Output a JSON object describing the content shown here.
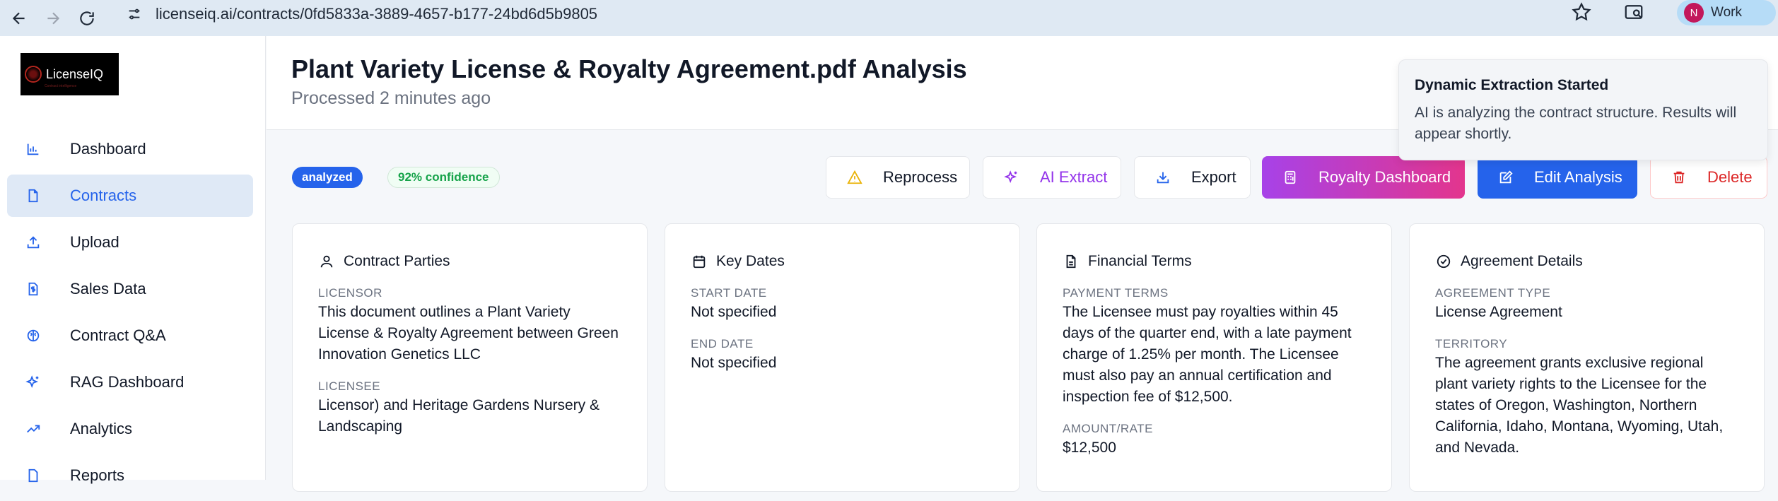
{
  "browser": {
    "url": "licenseiq.ai/contracts/0fd5833a-3889-4657-b177-24bd6d5b9805",
    "profile_initial": "N",
    "profile_label": "Work"
  },
  "sidebar": {
    "logo_text": "LicenseIQ",
    "logo_tagline": "Contract intelligence",
    "items": [
      {
        "label": "Dashboard",
        "icon": "bar-chart-icon"
      },
      {
        "label": "Contracts",
        "icon": "file-icon",
        "active": true
      },
      {
        "label": "Upload",
        "icon": "upload-icon"
      },
      {
        "label": "Sales Data",
        "icon": "dollar-file-icon"
      },
      {
        "label": "Contract Q&A",
        "icon": "brain-icon"
      },
      {
        "label": "RAG Dashboard",
        "icon": "sparkles-icon"
      },
      {
        "label": "Analytics",
        "icon": "trending-up-icon"
      },
      {
        "label": "Reports",
        "icon": "report-icon"
      }
    ]
  },
  "header": {
    "title": "Plant Variety License & Royalty Agreement.pdf Analysis",
    "subtitle": "Processed 2 minutes ago"
  },
  "toast": {
    "title": "Dynamic Extraction Started",
    "message": "AI is analyzing the contract structure. Results will appear shortly."
  },
  "badges": {
    "status": "analyzed",
    "confidence": "92% confidence"
  },
  "actions": {
    "reprocess": "Reprocess",
    "ai_extract": "AI Extract",
    "export": "Export",
    "royalty_dashboard": "Royalty Dashboard",
    "edit_analysis": "Edit Analysis",
    "delete": "Delete"
  },
  "cards": {
    "parties": {
      "title": "Contract Parties",
      "licensor_label": "LICENSOR",
      "licensor_value": "This document outlines a Plant Variety License & Royalty Agreement between Green Innovation Genetics LLC",
      "licensee_label": "LICENSEE",
      "licensee_value": "Licensor) and Heritage Gardens Nursery & Landscaping"
    },
    "dates": {
      "title": "Key Dates",
      "start_label": "START DATE",
      "start_value": "Not specified",
      "end_label": "END DATE",
      "end_value": "Not specified"
    },
    "financial": {
      "title": "Financial Terms",
      "payment_label": "PAYMENT TERMS",
      "payment_value": "The Licensee must pay royalties within 45 days of the quarter end, with a late payment charge of 1.25% per month. The Licensee must also pay an annual certification and inspection fee of $12,500.",
      "amount_label": "AMOUNT/RATE",
      "amount_value": "$12,500"
    },
    "agreement": {
      "title": "Agreement Details",
      "type_label": "AGREEMENT TYPE",
      "type_value": "License Agreement",
      "territory_label": "TERRITORY",
      "territory_value": "The agreement grants exclusive regional plant variety rights to the Licensee for the states of Oregon, Washington, Northern California, Idaho, Montana, Wyoming, Utah, and Nevada."
    }
  }
}
